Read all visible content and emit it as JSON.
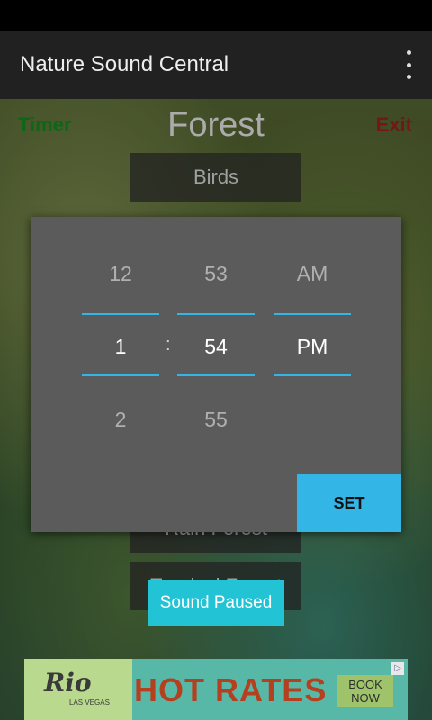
{
  "app": {
    "title": "Nature Sound Central"
  },
  "content": {
    "timer_label": "Timer",
    "exit_label": "Exit",
    "category_title": "Forest",
    "sound_buttons": [
      "Birds",
      "Rain Forest",
      "Tropical Forest"
    ]
  },
  "picker": {
    "hours": {
      "above": "12",
      "selected": "1",
      "below": "2"
    },
    "minutes": {
      "above": "53",
      "selected": "54",
      "below": "55"
    },
    "ampm": {
      "above": "AM",
      "selected": "PM"
    },
    "separator": ":",
    "set_label": "SET"
  },
  "toast": {
    "text": "Sound Paused"
  },
  "ad": {
    "brand": "Rio",
    "brand_sub": "LAS VEGAS",
    "headline": "HOT RATES",
    "cta_line1": "BOOK",
    "cta_line2": "NOW"
  },
  "colors": {
    "accent": "#33b5e5",
    "timer": "#0f7a1c",
    "exit": "#8b1a1a",
    "toast": "#22c3d4"
  }
}
